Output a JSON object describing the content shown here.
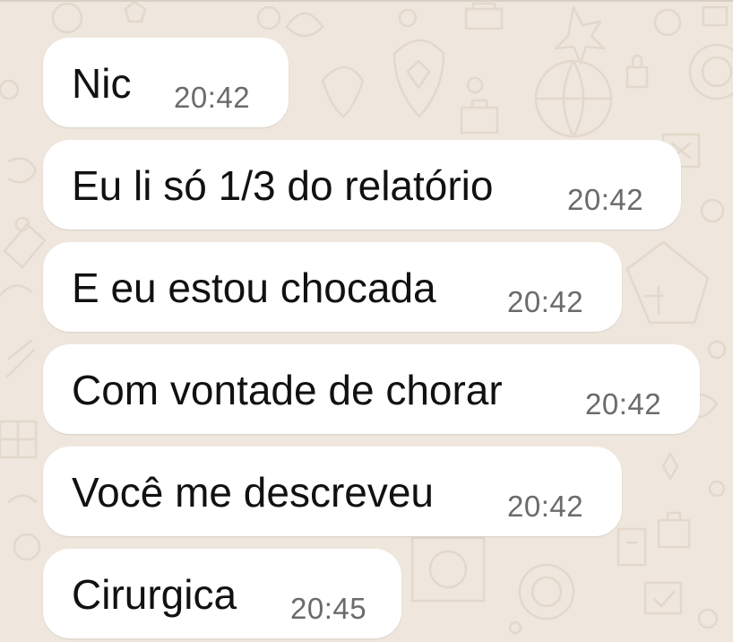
{
  "chat": {
    "messages": [
      {
        "text": "Nic",
        "time": "20:42"
      },
      {
        "text": "Eu li só 1/3 do relatório",
        "time": "20:42"
      },
      {
        "text": "E eu estou chocada",
        "time": "20:42"
      },
      {
        "text": "Com vontade de chorar",
        "time": "20:42"
      },
      {
        "text": "Você me descreveu",
        "time": "20:42"
      },
      {
        "text": "Cirurgica",
        "time": "20:45"
      }
    ]
  },
  "colors": {
    "wallpaper": "#efe7dd",
    "bubble": "#ffffff",
    "text": "#111111",
    "timestamp": "#6b6b6b"
  }
}
